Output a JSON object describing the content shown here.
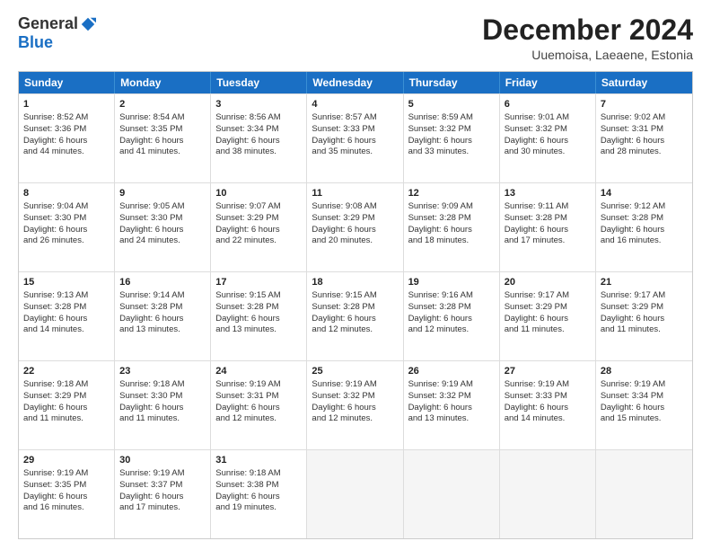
{
  "logo": {
    "general": "General",
    "blue": "Blue"
  },
  "header": {
    "month": "December 2024",
    "location": "Uuemoisa, Laeaene, Estonia"
  },
  "weekdays": [
    "Sunday",
    "Monday",
    "Tuesday",
    "Wednesday",
    "Thursday",
    "Friday",
    "Saturday"
  ],
  "weeks": [
    [
      {
        "day": "1",
        "lines": [
          "Sunrise: 8:52 AM",
          "Sunset: 3:36 PM",
          "Daylight: 6 hours",
          "and 44 minutes."
        ]
      },
      {
        "day": "2",
        "lines": [
          "Sunrise: 8:54 AM",
          "Sunset: 3:35 PM",
          "Daylight: 6 hours",
          "and 41 minutes."
        ]
      },
      {
        "day": "3",
        "lines": [
          "Sunrise: 8:56 AM",
          "Sunset: 3:34 PM",
          "Daylight: 6 hours",
          "and 38 minutes."
        ]
      },
      {
        "day": "4",
        "lines": [
          "Sunrise: 8:57 AM",
          "Sunset: 3:33 PM",
          "Daylight: 6 hours",
          "and 35 minutes."
        ]
      },
      {
        "day": "5",
        "lines": [
          "Sunrise: 8:59 AM",
          "Sunset: 3:32 PM",
          "Daylight: 6 hours",
          "and 33 minutes."
        ]
      },
      {
        "day": "6",
        "lines": [
          "Sunrise: 9:01 AM",
          "Sunset: 3:32 PM",
          "Daylight: 6 hours",
          "and 30 minutes."
        ]
      },
      {
        "day": "7",
        "lines": [
          "Sunrise: 9:02 AM",
          "Sunset: 3:31 PM",
          "Daylight: 6 hours",
          "and 28 minutes."
        ]
      }
    ],
    [
      {
        "day": "8",
        "lines": [
          "Sunrise: 9:04 AM",
          "Sunset: 3:30 PM",
          "Daylight: 6 hours",
          "and 26 minutes."
        ]
      },
      {
        "day": "9",
        "lines": [
          "Sunrise: 9:05 AM",
          "Sunset: 3:30 PM",
          "Daylight: 6 hours",
          "and 24 minutes."
        ]
      },
      {
        "day": "10",
        "lines": [
          "Sunrise: 9:07 AM",
          "Sunset: 3:29 PM",
          "Daylight: 6 hours",
          "and 22 minutes."
        ]
      },
      {
        "day": "11",
        "lines": [
          "Sunrise: 9:08 AM",
          "Sunset: 3:29 PM",
          "Daylight: 6 hours",
          "and 20 minutes."
        ]
      },
      {
        "day": "12",
        "lines": [
          "Sunrise: 9:09 AM",
          "Sunset: 3:28 PM",
          "Daylight: 6 hours",
          "and 18 minutes."
        ]
      },
      {
        "day": "13",
        "lines": [
          "Sunrise: 9:11 AM",
          "Sunset: 3:28 PM",
          "Daylight: 6 hours",
          "and 17 minutes."
        ]
      },
      {
        "day": "14",
        "lines": [
          "Sunrise: 9:12 AM",
          "Sunset: 3:28 PM",
          "Daylight: 6 hours",
          "and 16 minutes."
        ]
      }
    ],
    [
      {
        "day": "15",
        "lines": [
          "Sunrise: 9:13 AM",
          "Sunset: 3:28 PM",
          "Daylight: 6 hours",
          "and 14 minutes."
        ]
      },
      {
        "day": "16",
        "lines": [
          "Sunrise: 9:14 AM",
          "Sunset: 3:28 PM",
          "Daylight: 6 hours",
          "and 13 minutes."
        ]
      },
      {
        "day": "17",
        "lines": [
          "Sunrise: 9:15 AM",
          "Sunset: 3:28 PM",
          "Daylight: 6 hours",
          "and 13 minutes."
        ]
      },
      {
        "day": "18",
        "lines": [
          "Sunrise: 9:15 AM",
          "Sunset: 3:28 PM",
          "Daylight: 6 hours",
          "and 12 minutes."
        ]
      },
      {
        "day": "19",
        "lines": [
          "Sunrise: 9:16 AM",
          "Sunset: 3:28 PM",
          "Daylight: 6 hours",
          "and 12 minutes."
        ]
      },
      {
        "day": "20",
        "lines": [
          "Sunrise: 9:17 AM",
          "Sunset: 3:29 PM",
          "Daylight: 6 hours",
          "and 11 minutes."
        ]
      },
      {
        "day": "21",
        "lines": [
          "Sunrise: 9:17 AM",
          "Sunset: 3:29 PM",
          "Daylight: 6 hours",
          "and 11 minutes."
        ]
      }
    ],
    [
      {
        "day": "22",
        "lines": [
          "Sunrise: 9:18 AM",
          "Sunset: 3:29 PM",
          "Daylight: 6 hours",
          "and 11 minutes."
        ]
      },
      {
        "day": "23",
        "lines": [
          "Sunrise: 9:18 AM",
          "Sunset: 3:30 PM",
          "Daylight: 6 hours",
          "and 11 minutes."
        ]
      },
      {
        "day": "24",
        "lines": [
          "Sunrise: 9:19 AM",
          "Sunset: 3:31 PM",
          "Daylight: 6 hours",
          "and 12 minutes."
        ]
      },
      {
        "day": "25",
        "lines": [
          "Sunrise: 9:19 AM",
          "Sunset: 3:32 PM",
          "Daylight: 6 hours",
          "and 12 minutes."
        ]
      },
      {
        "day": "26",
        "lines": [
          "Sunrise: 9:19 AM",
          "Sunset: 3:32 PM",
          "Daylight: 6 hours",
          "and 13 minutes."
        ]
      },
      {
        "day": "27",
        "lines": [
          "Sunrise: 9:19 AM",
          "Sunset: 3:33 PM",
          "Daylight: 6 hours",
          "and 14 minutes."
        ]
      },
      {
        "day": "28",
        "lines": [
          "Sunrise: 9:19 AM",
          "Sunset: 3:34 PM",
          "Daylight: 6 hours",
          "and 15 minutes."
        ]
      }
    ],
    [
      {
        "day": "29",
        "lines": [
          "Sunrise: 9:19 AM",
          "Sunset: 3:35 PM",
          "Daylight: 6 hours",
          "and 16 minutes."
        ]
      },
      {
        "day": "30",
        "lines": [
          "Sunrise: 9:19 AM",
          "Sunset: 3:37 PM",
          "Daylight: 6 hours",
          "and 17 minutes."
        ]
      },
      {
        "day": "31",
        "lines": [
          "Sunrise: 9:18 AM",
          "Sunset: 3:38 PM",
          "Daylight: 6 hours",
          "and 19 minutes."
        ]
      },
      {
        "day": "",
        "lines": []
      },
      {
        "day": "",
        "lines": []
      },
      {
        "day": "",
        "lines": []
      },
      {
        "day": "",
        "lines": []
      }
    ]
  ]
}
